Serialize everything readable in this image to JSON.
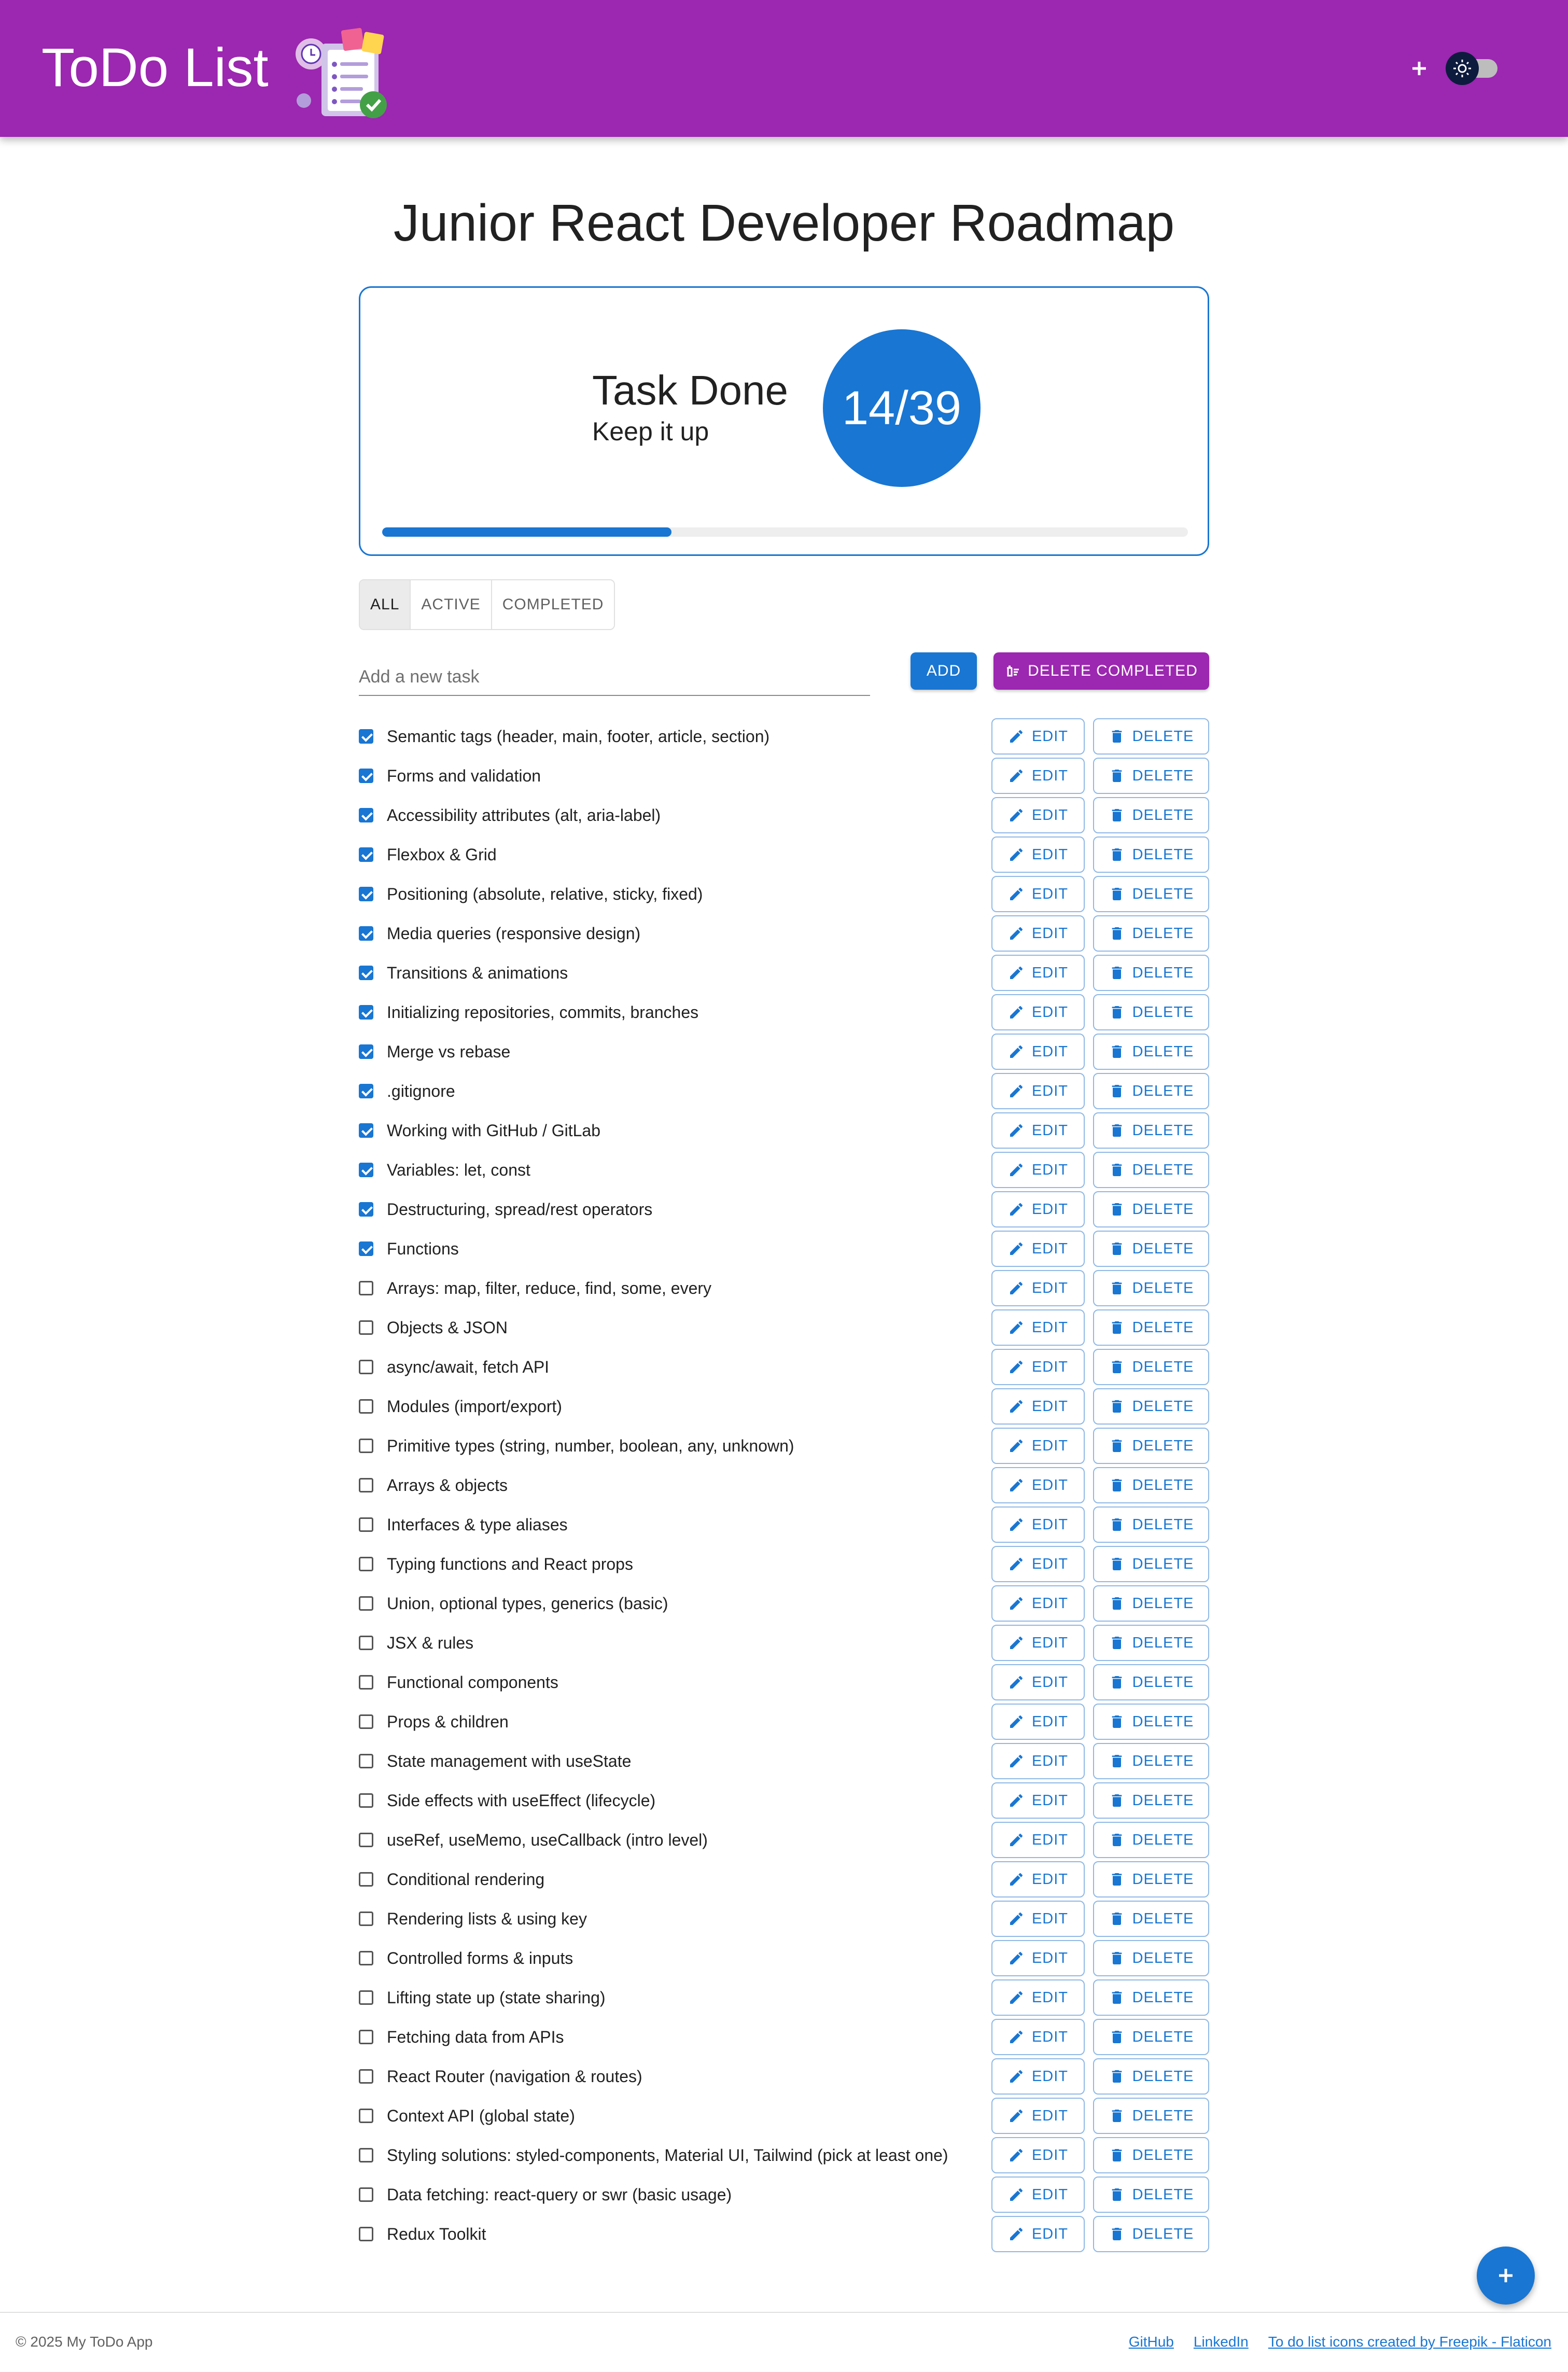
{
  "header": {
    "title": "ToDo List"
  },
  "main": {
    "title": "Junior React Developer Roadmap",
    "progress": {
      "title": "Task Done",
      "subtitle": "Keep it up",
      "count_label": "14/39",
      "completed": 14,
      "total": 39
    },
    "filters": [
      {
        "label": "ALL",
        "selected": true
      },
      {
        "label": "ACTIVE",
        "selected": false
      },
      {
        "label": "COMPLETED",
        "selected": false
      }
    ],
    "new_task": {
      "placeholder": "Add a new task",
      "value": ""
    },
    "add_label": "ADD",
    "delete_completed_label": "DELETE COMPLETED",
    "edit_label": "EDIT",
    "delete_label": "DELETE",
    "tasks": [
      {
        "text": "Semantic tags (header, main, footer, article, section)",
        "done": true
      },
      {
        "text": "Forms and validation",
        "done": true
      },
      {
        "text": "Accessibility attributes (alt, aria-label)",
        "done": true
      },
      {
        "text": "Flexbox & Grid",
        "done": true
      },
      {
        "text": "Positioning (absolute, relative, sticky, fixed)",
        "done": true
      },
      {
        "text": "Media queries (responsive design)",
        "done": true
      },
      {
        "text": "Transitions & animations",
        "done": true
      },
      {
        "text": "Initializing repositories, commits, branches",
        "done": true
      },
      {
        "text": "Merge vs rebase",
        "done": true
      },
      {
        "text": ".gitignore",
        "done": true
      },
      {
        "text": "Working with GitHub / GitLab",
        "done": true
      },
      {
        "text": "Variables: let, const",
        "done": true
      },
      {
        "text": "Destructuring, spread/rest operators",
        "done": true
      },
      {
        "text": "Functions",
        "done": true
      },
      {
        "text": "Arrays: map, filter, reduce, find, some, every",
        "done": false
      },
      {
        "text": "Objects & JSON",
        "done": false
      },
      {
        "text": "async/await, fetch API",
        "done": false
      },
      {
        "text": "Modules (import/export)",
        "done": false
      },
      {
        "text": "Primitive types (string, number, boolean, any, unknown)",
        "done": false
      },
      {
        "text": "Arrays & objects",
        "done": false
      },
      {
        "text": "Interfaces & type aliases",
        "done": false
      },
      {
        "text": "Typing functions and React props",
        "done": false
      },
      {
        "text": "Union, optional types, generics (basic)",
        "done": false
      },
      {
        "text": "JSX & rules",
        "done": false
      },
      {
        "text": "Functional components",
        "done": false
      },
      {
        "text": "Props & children",
        "done": false
      },
      {
        "text": "State management with useState",
        "done": false
      },
      {
        "text": "Side effects with useEffect (lifecycle)",
        "done": false
      },
      {
        "text": "useRef, useMemo, useCallback (intro level)",
        "done": false
      },
      {
        "text": "Conditional rendering",
        "done": false
      },
      {
        "text": "Rendering lists & using key",
        "done": false
      },
      {
        "text": "Controlled forms & inputs",
        "done": false
      },
      {
        "text": "Lifting state up (state sharing)",
        "done": false
      },
      {
        "text": "Fetching data from APIs",
        "done": false
      },
      {
        "text": "React Router (navigation & routes)",
        "done": false
      },
      {
        "text": "Context API (global state)",
        "done": false
      },
      {
        "text": "Styling solutions: styled-components, Material UI, Tailwind (pick at least one)",
        "done": false
      },
      {
        "text": "Data fetching: react-query or swr (basic usage)",
        "done": false
      },
      {
        "text": "Redux Toolkit",
        "done": false
      }
    ]
  },
  "footer": {
    "copyright": "© 2025 My ToDo App",
    "links": [
      "GitHub",
      "LinkedIn",
      "To do list icons created by Freepik - Flaticon"
    ]
  },
  "colors": {
    "appbar": "#9c27b0",
    "primary": "#1976d2",
    "secondary": "#9c27b0"
  },
  "icons": [
    "todo-logo",
    "plus-icon",
    "sun-icon",
    "edit-icon",
    "trash-icon",
    "delete-sweep-icon"
  ]
}
